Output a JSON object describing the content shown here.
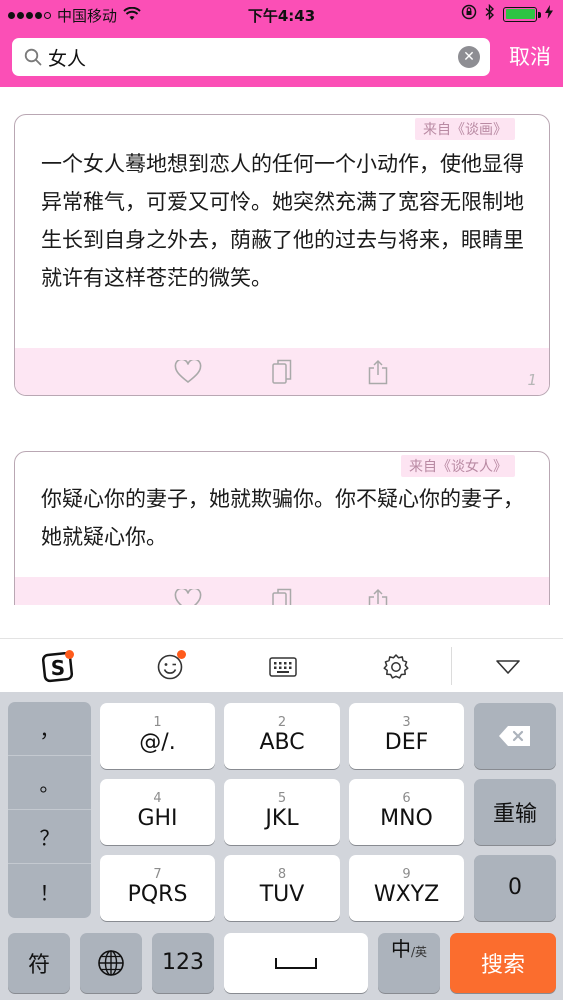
{
  "status_bar": {
    "carrier": "中国移动",
    "time": "下午4:43"
  },
  "search": {
    "query": "女人",
    "cancel_label": "取消"
  },
  "cards": [
    {
      "source": "来自《谈画》",
      "text": "一个女人蓦地想到恋人的任何一个小动作，使他显得异常稚气，可爱又可怜。她突然充满了宽容无限制地生长到自身之外去，荫蔽了他的过去与将来，眼睛里就许有这样苍茫的微笑。",
      "number": "1"
    },
    {
      "source": "来自《谈女人》",
      "text": "你疑心你的妻子，她就欺骗你。你不疑心你的妻子，她就疑心你。"
    }
  ],
  "keyboard": {
    "punctuation": [
      "，",
      "。",
      "？",
      "！"
    ],
    "keys": {
      "k1": {
        "num": "1",
        "label": "@/."
      },
      "k2": {
        "num": "2",
        "label": "ABC"
      },
      "k3": {
        "num": "3",
        "label": "DEF"
      },
      "k4": {
        "num": "4",
        "label": "GHI"
      },
      "k5": {
        "num": "5",
        "label": "JKL"
      },
      "k6": {
        "num": "6",
        "label": "MNO"
      },
      "k7": {
        "num": "7",
        "label": "PQRS"
      },
      "k8": {
        "num": "8",
        "label": "TUV"
      },
      "k9": {
        "num": "9",
        "label": "WXYZ"
      },
      "k0": {
        "label": "0"
      }
    },
    "retype_label": "重输",
    "symbol_label": "符",
    "num_label": "123",
    "lang_main": "中",
    "lang_sub": "/英",
    "search_label": "搜索"
  },
  "colors": {
    "header": "#fb4fb6",
    "search_key": "#fb6d2e",
    "card_action_bg": "#fde6f3"
  },
  "battery_level": 1.0
}
